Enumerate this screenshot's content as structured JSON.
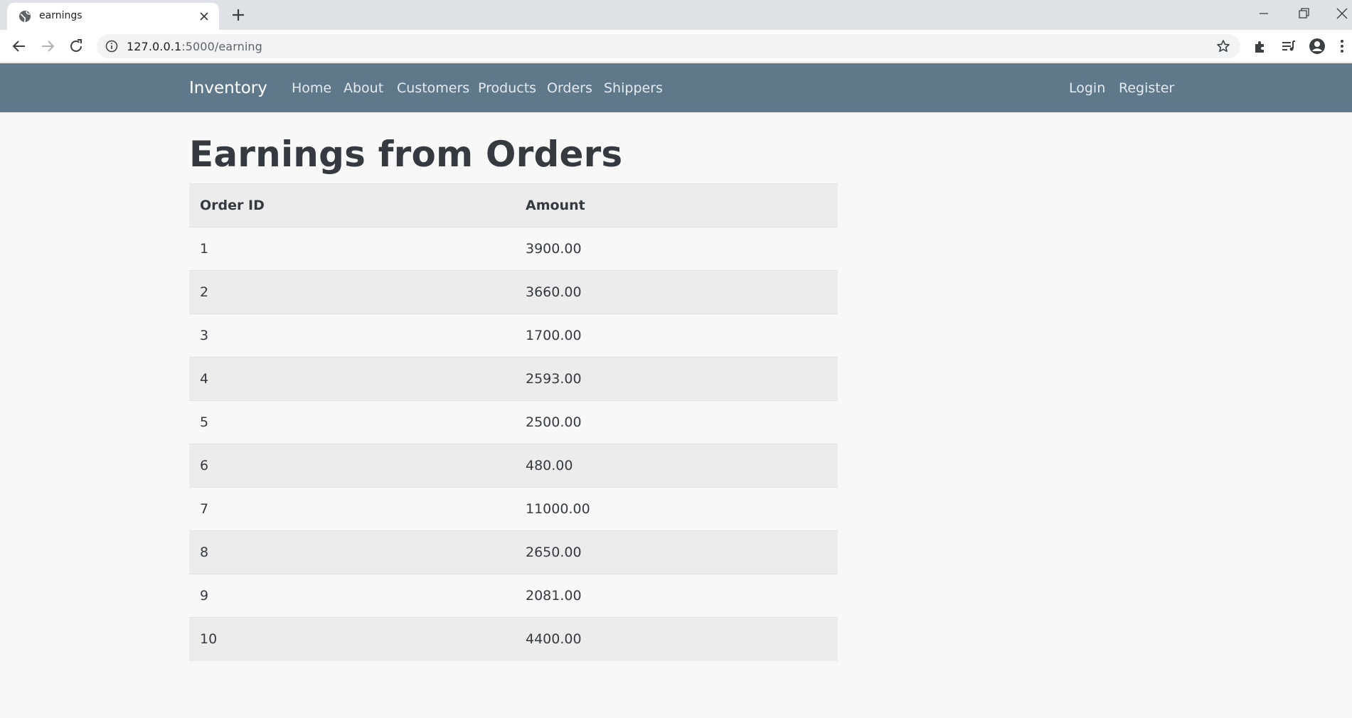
{
  "browser": {
    "tab_title": "earnings",
    "url_host": "127.0.0.1",
    "url_path": ":5000/earning"
  },
  "navbar": {
    "brand": "Inventory",
    "links": [
      "Home",
      "About",
      "Customers",
      "Products",
      "Orders",
      "Shippers"
    ],
    "right_links": [
      "Login",
      "Register"
    ],
    "background_color": "#5f788a"
  },
  "page": {
    "title": "Earnings from Orders"
  },
  "table": {
    "headers": [
      "Order ID",
      "Amount"
    ],
    "rows": [
      [
        "1",
        "3900.00"
      ],
      [
        "2",
        "3660.00"
      ],
      [
        "3",
        "1700.00"
      ],
      [
        "4",
        "2593.00"
      ],
      [
        "5",
        "2500.00"
      ],
      [
        "6",
        "480.00"
      ],
      [
        "7",
        "11000.00"
      ],
      [
        "8",
        "2650.00"
      ],
      [
        "9",
        "2081.00"
      ],
      [
        "10",
        "4400.00"
      ]
    ]
  }
}
